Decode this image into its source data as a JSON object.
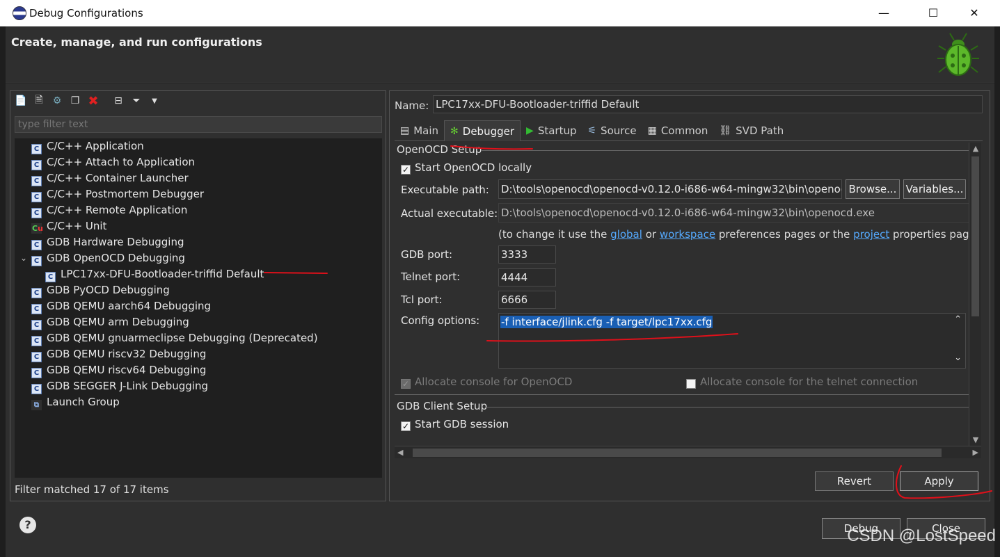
{
  "window": {
    "title": "Debug Configurations"
  },
  "header": {
    "title": "Create, manage, and run configurations"
  },
  "left": {
    "filter_placeholder": "type filter text",
    "tree": [
      {
        "label": "C/C++ Application"
      },
      {
        "label": "C/C++ Attach to Application"
      },
      {
        "label": "C/C++ Container Launcher"
      },
      {
        "label": "C/C++ Postmortem Debugger"
      },
      {
        "label": "C/C++ Remote Application"
      },
      {
        "label": "C/C++ Unit"
      },
      {
        "label": "GDB Hardware Debugging"
      },
      {
        "label": "GDB OpenOCD Debugging"
      },
      {
        "label": "LPC17xx-DFU-Bootloader-triffid Default"
      },
      {
        "label": "GDB PyOCD Debugging"
      },
      {
        "label": "GDB QEMU aarch64 Debugging"
      },
      {
        "label": "GDB QEMU arm Debugging"
      },
      {
        "label": "GDB QEMU gnuarmeclipse Debugging (Deprecated)"
      },
      {
        "label": "GDB QEMU riscv32 Debugging"
      },
      {
        "label": "GDB QEMU riscv64 Debugging"
      },
      {
        "label": "GDB SEGGER J-Link Debugging"
      },
      {
        "label": "Launch Group"
      }
    ],
    "status": "Filter matched 17 of 17 items"
  },
  "right": {
    "name_label": "Name:",
    "name_value": "LPC17xx-DFU-Bootloader-triffid Default",
    "tabs": [
      {
        "label": "Main"
      },
      {
        "label": "Debugger"
      },
      {
        "label": "Startup"
      },
      {
        "label": "Source"
      },
      {
        "label": "Common"
      },
      {
        "label": "SVD Path"
      }
    ],
    "openocd": {
      "group_title": "OpenOCD Setup",
      "start_locally": "Start OpenOCD locally",
      "exec_label": "Executable path:",
      "exec_value": "D:\\tools\\openocd\\openocd-v0.12.0-i686-w64-mingw32\\bin\\openocd",
      "browse": "Browse...",
      "variables": "Variables...",
      "actual_label": "Actual executable:",
      "actual_value": "D:\\tools\\openocd\\openocd-v0.12.0-i686-w64-mingw32\\bin\\openocd.exe",
      "hint_prefix": "(to change it use the ",
      "hint_global": "global",
      "hint_or": " or ",
      "hint_workspace": "workspace",
      "hint_mid": " preferences pages or the ",
      "hint_project": "project",
      "hint_suffix": " properties page)",
      "gdb_port_label": "GDB port:",
      "gdb_port": "3333",
      "telnet_port_label": "Telnet port:",
      "telnet_port": "4444",
      "tcl_port_label": "Tcl port:",
      "tcl_port": "6666",
      "config_label": "Config options:",
      "config_value": "-f interface/jlink.cfg -f target/lpc17xx.cfg",
      "alloc_console": "Allocate console for OpenOCD",
      "alloc_telnet": "Allocate console for the telnet connection"
    },
    "gdb": {
      "group_title": "GDB Client Setup",
      "start_session": "Start GDB session"
    },
    "revert": "Revert",
    "apply": "Apply"
  },
  "footer": {
    "debug": "Debug",
    "close": "Close",
    "help": "?"
  },
  "watermark": "CSDN @LostSpeed",
  "colors": {
    "annotation": "#e0101a",
    "link": "#55aaff",
    "selection": "#1a5fb4"
  }
}
